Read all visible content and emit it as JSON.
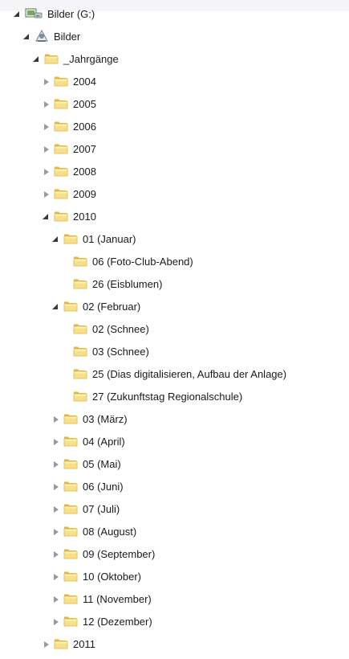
{
  "tree": {
    "nodes": [
      {
        "depth": 0,
        "state": "expanded",
        "icon": "drive-icon",
        "label": "Bilder (G:)"
      },
      {
        "depth": 1,
        "state": "expanded",
        "icon": "library-icon",
        "label": "Bilder"
      },
      {
        "depth": 2,
        "state": "expanded",
        "icon": "folder-icon",
        "label": "_Jahrgänge"
      },
      {
        "depth": 3,
        "state": "collapsed",
        "icon": "folder-icon",
        "label": "2004"
      },
      {
        "depth": 3,
        "state": "collapsed",
        "icon": "folder-icon",
        "label": "2005"
      },
      {
        "depth": 3,
        "state": "collapsed",
        "icon": "folder-icon",
        "label": "2006"
      },
      {
        "depth": 3,
        "state": "collapsed",
        "icon": "folder-icon",
        "label": "2007"
      },
      {
        "depth": 3,
        "state": "collapsed",
        "icon": "folder-icon",
        "label": "2008"
      },
      {
        "depth": 3,
        "state": "collapsed",
        "icon": "folder-icon",
        "label": "2009"
      },
      {
        "depth": 3,
        "state": "expanded",
        "icon": "folder-icon",
        "label": "2010"
      },
      {
        "depth": 4,
        "state": "expanded",
        "icon": "folder-icon",
        "label": "01 (Januar)"
      },
      {
        "depth": 5,
        "state": "none",
        "icon": "folder-icon",
        "label": "06 (Foto-Club-Abend)"
      },
      {
        "depth": 5,
        "state": "none",
        "icon": "folder-icon",
        "label": "26 (Eisblumen)"
      },
      {
        "depth": 4,
        "state": "expanded",
        "icon": "folder-icon",
        "label": "02 (Februar)"
      },
      {
        "depth": 5,
        "state": "none",
        "icon": "folder-icon",
        "label": "02 (Schnee)"
      },
      {
        "depth": 5,
        "state": "none",
        "icon": "folder-icon",
        "label": "03 (Schnee)"
      },
      {
        "depth": 5,
        "state": "none",
        "icon": "folder-icon",
        "label": "25 (Dias digitalisieren, Aufbau der Anlage)"
      },
      {
        "depth": 5,
        "state": "none",
        "icon": "folder-icon",
        "label": "27 (Zukunftstag Regionalschule)"
      },
      {
        "depth": 4,
        "state": "collapsed",
        "icon": "folder-icon",
        "label": "03 (März)"
      },
      {
        "depth": 4,
        "state": "collapsed",
        "icon": "folder-icon",
        "label": "04 (April)"
      },
      {
        "depth": 4,
        "state": "collapsed",
        "icon": "folder-icon",
        "label": "05 (Mai)"
      },
      {
        "depth": 4,
        "state": "collapsed",
        "icon": "folder-icon",
        "label": "06 (Juni)"
      },
      {
        "depth": 4,
        "state": "collapsed",
        "icon": "folder-icon",
        "label": "07 (Juli)"
      },
      {
        "depth": 4,
        "state": "collapsed",
        "icon": "folder-icon",
        "label": "08 (August)"
      },
      {
        "depth": 4,
        "state": "collapsed",
        "icon": "folder-icon",
        "label": "09 (September)"
      },
      {
        "depth": 4,
        "state": "collapsed",
        "icon": "folder-icon",
        "label": "10 (Oktober)"
      },
      {
        "depth": 4,
        "state": "collapsed",
        "icon": "folder-icon",
        "label": "11 (November)"
      },
      {
        "depth": 4,
        "state": "collapsed",
        "icon": "folder-icon",
        "label": "12 (Dezember)"
      },
      {
        "depth": 3,
        "state": "collapsed",
        "icon": "folder-icon",
        "label": "2011"
      }
    ]
  },
  "colors": {
    "folder_light": "#f7e08a",
    "folder_dark": "#e0b53a",
    "expander_filled": "#3a3a3a",
    "expander_hollow": "#9a9a9a",
    "top_bar": "#f5f5f7"
  }
}
